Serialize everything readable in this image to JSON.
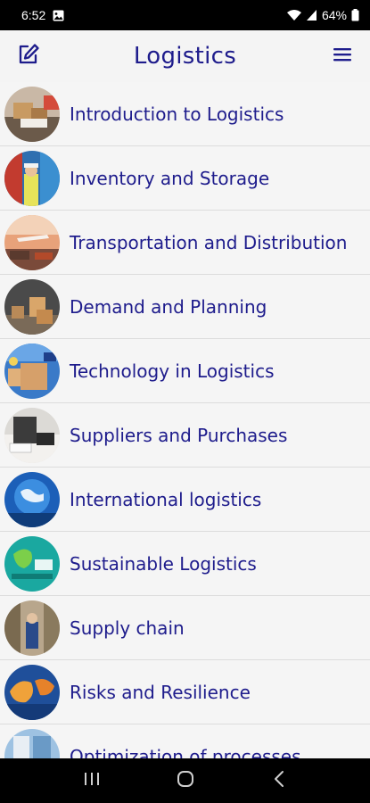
{
  "status_bar": {
    "time": "6:52",
    "battery": "64%"
  },
  "header": {
    "title": "Logistics"
  },
  "topics": [
    {
      "label": "Introduction to Logistics"
    },
    {
      "label": "Inventory and Storage"
    },
    {
      "label": "Transportation and Distribution"
    },
    {
      "label": "Demand and Planning"
    },
    {
      "label": "Technology in Logistics"
    },
    {
      "label": "Suppliers and Purchases"
    },
    {
      "label": "International logistics"
    },
    {
      "label": "Sustainable Logistics"
    },
    {
      "label": "Supply chain"
    },
    {
      "label": "Risks and Resilience"
    },
    {
      "label": "Optimization of processes"
    }
  ],
  "icons": {
    "edit": "edit-icon",
    "menu": "menu-icon",
    "recents": "recents-icon",
    "home": "home-icon",
    "back": "back-icon"
  },
  "colors": {
    "accent": "#1e1c8c",
    "background": "#f5f5f5",
    "divider": "#dcdcdc"
  }
}
